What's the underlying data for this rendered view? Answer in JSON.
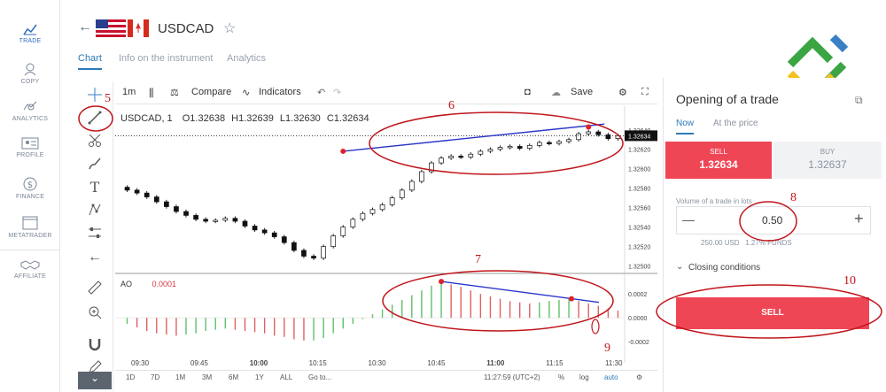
{
  "nav": {
    "items": [
      {
        "label": "TRADE",
        "icon": "chart-icon"
      },
      {
        "label": "COPY",
        "icon": "users-icon"
      },
      {
        "label": "ANALYTICS",
        "icon": "analytics-icon"
      },
      {
        "label": "PROFILE",
        "icon": "profile-icon"
      },
      {
        "label": "FINANCE",
        "icon": "dollar-icon"
      },
      {
        "label": "METATRADER",
        "icon": "window-icon"
      },
      {
        "label": "AFFILIATE",
        "icon": "handshake-icon"
      }
    ]
  },
  "header": {
    "symbol": "USDCAD",
    "tabs": [
      "Chart",
      "Info on the instrument",
      "Analytics"
    ]
  },
  "chart_toolbar": {
    "interval": "1m",
    "compare": "Compare",
    "indicators": "Indicators",
    "save": "Save"
  },
  "legend": {
    "symbol": "USDCAD, 1",
    "o": "O1.32638",
    "h": "H1.32639",
    "l": "L1.32630",
    "c": "C1.32634"
  },
  "ao": {
    "label": "AO",
    "value": "0.0001"
  },
  "annotations": [
    "5",
    "6",
    "7",
    "8",
    "9",
    "10"
  ],
  "chart_data": {
    "type": "candlestick",
    "x_ticks": [
      "09:30",
      "09:45",
      "10:00",
      "10:15",
      "10:30",
      "10:45",
      "11:00",
      "11:15",
      "11:30"
    ],
    "y_ticks": [
      "1.32640",
      "1.32620",
      "1.32600",
      "1.32580",
      "1.32560",
      "1.32540",
      "1.32520",
      "1.32500"
    ],
    "last_price": "1.32634",
    "ao_ticks": [
      "0.0002",
      "0.0000",
      "-0.0002"
    ],
    "close": [
      1.32578,
      1.32575,
      1.32571,
      1.32566,
      1.32561,
      1.32556,
      1.32552,
      1.32548,
      1.32546,
      1.32547,
      1.32549,
      1.32546,
      1.32541,
      1.32537,
      1.32534,
      1.3253,
      1.32524,
      1.32516,
      1.3251,
      1.32508,
      1.3252,
      1.32531,
      1.3254,
      1.32548,
      1.32554,
      1.32558,
      1.32563,
      1.3257,
      1.32578,
      1.32587,
      1.32597,
      1.32606,
      1.32611,
      1.32613,
      1.32612,
      1.32615,
      1.32618,
      1.3262,
      1.32622,
      1.32623,
      1.32621,
      1.32624,
      1.32627,
      1.32626,
      1.32628,
      1.3263,
      1.32636,
      1.32638,
      1.32635,
      1.32631,
      1.32634
    ],
    "ao": [
      -5e-05,
      -8e-05,
      -0.00011,
      -0.00013,
      -0.00014,
      -0.00015,
      -0.00014,
      -0.00013,
      -0.00011,
      -0.0001,
      -9e-05,
      -0.0001,
      -0.00011,
      -0.00012,
      -0.00013,
      -0.00015,
      -0.00016,
      -0.00018,
      -0.00019,
      -0.00019,
      -0.00017,
      -0.00013,
      -9e-05,
      -5e-05,
      -1e-05,
      3e-05,
      7e-05,
      0.00011,
      0.00015,
      0.00019,
      0.00023,
      0.00027,
      0.00029,
      0.00028,
      0.00026,
      0.00023,
      0.0002,
      0.00018,
      0.00016,
      0.00014,
      0.00013,
      0.00012,
      0.00013,
      0.00014,
      0.00015,
      0.00016,
      0.00014,
      0.00012,
      0.0001,
      8e-05,
      6e-05
    ]
  },
  "bottom_bar": {
    "ranges": [
      "1D",
      "7D",
      "1M",
      "3M",
      "6M",
      "1Y",
      "ALL"
    ],
    "goto": "Go to...",
    "time": "11:27:59 (UTC+2)",
    "pct": "%",
    "log": "log",
    "auto": "auto"
  },
  "trade_panel": {
    "title": "Opening of a trade",
    "tabs": [
      "Now",
      "At the price"
    ],
    "sell_label": "SELL",
    "sell_price": "1.32634",
    "buy_label": "BUY",
    "buy_price": "1.32637",
    "volume_label": "Volume of a trade in lots",
    "volume": "0.50",
    "minus": "—",
    "plus": "+",
    "funds": "250.00 USD   1.27% FUNDS",
    "closing": "Closing conditions",
    "sell_button": "SELL"
  },
  "colors": {
    "sell": "#ef4656",
    "buy": "#f1f2f4",
    "accent": "#2b7ab8",
    "annotation": "#c0151b",
    "trend": "#2a36c9"
  }
}
